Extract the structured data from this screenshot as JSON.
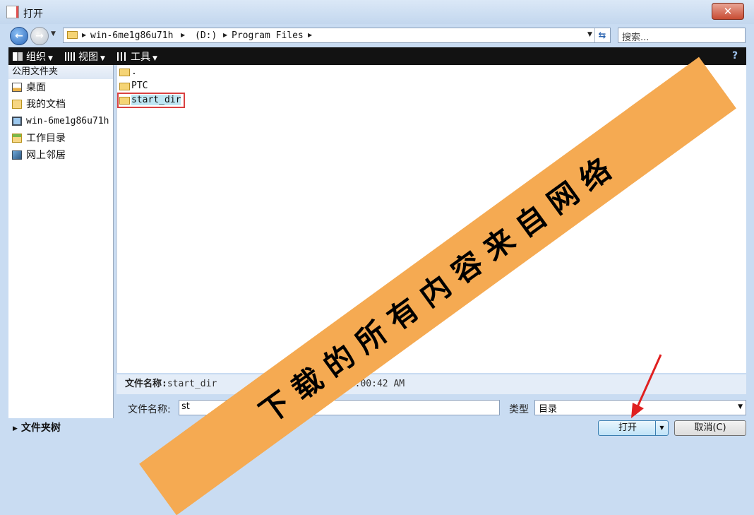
{
  "window": {
    "title": "打开",
    "close_glyph": "✕"
  },
  "nav": {
    "back_glyph": "←",
    "forward_glyph": "→",
    "history_glyph": "▼",
    "breadcrumbs": [
      "win-6me1g86u71h",
      "(D:)",
      "Program Files"
    ],
    "search_placeholder": "搜索..."
  },
  "toolbar": {
    "organize": "组织",
    "view": "视图",
    "tools": "工具"
  },
  "sidebar": {
    "header": "公用文件夹",
    "items": [
      {
        "label": "桌面",
        "icon": "desktop-icon"
      },
      {
        "label": "我的文档",
        "icon": "documents-icon"
      },
      {
        "label": "win-6me1g86u71h",
        "icon": "computer-icon"
      },
      {
        "label": "工作目录",
        "icon": "working-directory-icon"
      },
      {
        "label": "网上邻居",
        "icon": "network-icon"
      }
    ],
    "tree_label": "文件夹树"
  },
  "files": [
    {
      "name": ".",
      "icon": "folder-icon",
      "selected": false
    },
    {
      "name": "PTC",
      "icon": "folder-icon",
      "selected": false
    },
    {
      "name": "start_dir",
      "icon": "folder-icon",
      "selected": true
    }
  ],
  "info": {
    "label": "文件名称:",
    "name": "start_dir",
    "time": "11:00:42 AM"
  },
  "bottom": {
    "file_name_label": "文件名称:",
    "file_name_value": "st",
    "type_label": "类型",
    "type_value": "目录",
    "open_label": "打开",
    "cancel_label": "取消(C)"
  },
  "watermark": {
    "text": "下载的所有内容来自网络",
    "color": "#f5aa52"
  },
  "colors": {
    "selection_outline": "#d94141",
    "selection_fill": "#bfe6f3",
    "toolbar": "#121212"
  }
}
